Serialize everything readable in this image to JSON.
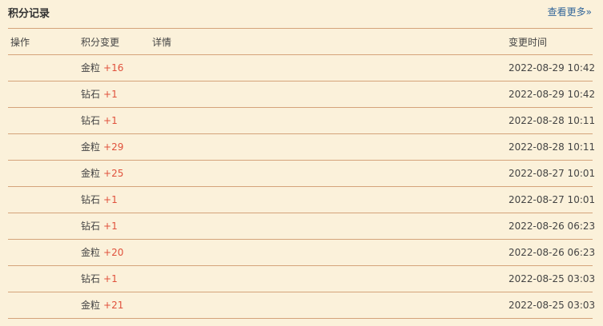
{
  "header": {
    "title": "积分记录",
    "more_link": "查看更多»"
  },
  "table": {
    "columns": [
      "操作",
      "积分变更",
      "详情",
      "变更时间"
    ],
    "rows": [
      {
        "type": "金粒",
        "amount": "+16",
        "time": "2022-08-29 10:42"
      },
      {
        "type": "钻石",
        "amount": "+1",
        "time": "2022-08-29 10:42"
      },
      {
        "type": "钻石",
        "amount": "+1",
        "time": "2022-08-28 10:11"
      },
      {
        "type": "金粒",
        "amount": "+29",
        "time": "2022-08-28 10:11"
      },
      {
        "type": "金粒",
        "amount": "+25",
        "time": "2022-08-27 10:01"
      },
      {
        "type": "钻石",
        "amount": "+1",
        "time": "2022-08-27 10:01"
      },
      {
        "type": "钻石",
        "amount": "+1",
        "time": "2022-08-26 06:23"
      },
      {
        "type": "金粒",
        "amount": "+20",
        "time": "2022-08-26 06:23"
      },
      {
        "type": "钻石",
        "amount": "+1",
        "time": "2022-08-25 03:03"
      },
      {
        "type": "金粒",
        "amount": "+21",
        "time": "2022-08-25 03:03"
      }
    ]
  },
  "colors": {
    "background": "#fbf1da",
    "divider": "#d4a37a",
    "amount": "#e0513c",
    "link": "#336699"
  }
}
